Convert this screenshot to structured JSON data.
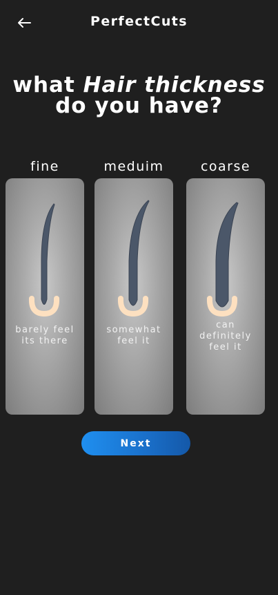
{
  "header": {
    "back_icon": "arrow-left-icon",
    "title": "PerfectCuts"
  },
  "question": {
    "prefix": "what ",
    "emphasis": "Hair thickness",
    "line2": "do you have?"
  },
  "options": [
    {
      "label": "fine",
      "description": "barely feel its there",
      "icon": "hair-strand-fine-icon"
    },
    {
      "label": "meduim",
      "description": "somewhat feel it",
      "icon": "hair-strand-medium-icon"
    },
    {
      "label": "coarse",
      "description": "can definitely feel it",
      "icon": "hair-strand-coarse-icon"
    }
  ],
  "next_button": {
    "label": "Next"
  },
  "colors": {
    "background": "#1f1f1f",
    "card": "#a8a8a8",
    "hair": "#4b5769",
    "follicle": "#fde0c0",
    "button": "#1f8ff0"
  }
}
